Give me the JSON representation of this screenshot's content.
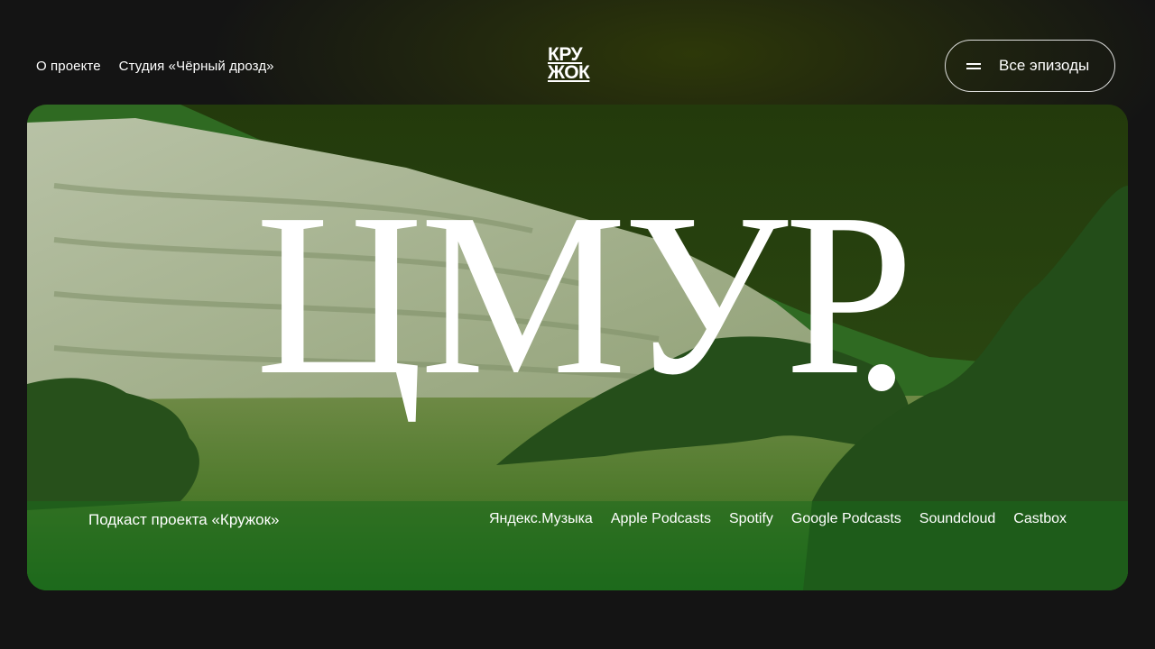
{
  "nav": {
    "items": [
      {
        "label": "О проекте"
      },
      {
        "label": "Студия «Чёрный дрозд»"
      }
    ]
  },
  "logo": {
    "line1": "КРУ",
    "line2": "ЖОК"
  },
  "episodes_button": {
    "label": "Все эпизоды",
    "icon": "menu-icon"
  },
  "hero": {
    "title": "ЦМУР"
  },
  "footer": {
    "tagline": "Подкаст проекта «Кружок»",
    "platforms": [
      {
        "label": "Яндекс.Музыка"
      },
      {
        "label": "Apple Podcasts"
      },
      {
        "label": "Spotify"
      },
      {
        "label": "Google Podcasts"
      },
      {
        "label": "Soundcloud"
      },
      {
        "label": "Castbox"
      }
    ]
  },
  "colors": {
    "background": "#141414",
    "hill_light": "#a7b596",
    "hill_green": "#3a7a2a",
    "foliage_dark": "#1c4a16",
    "text": "#ffffff"
  }
}
